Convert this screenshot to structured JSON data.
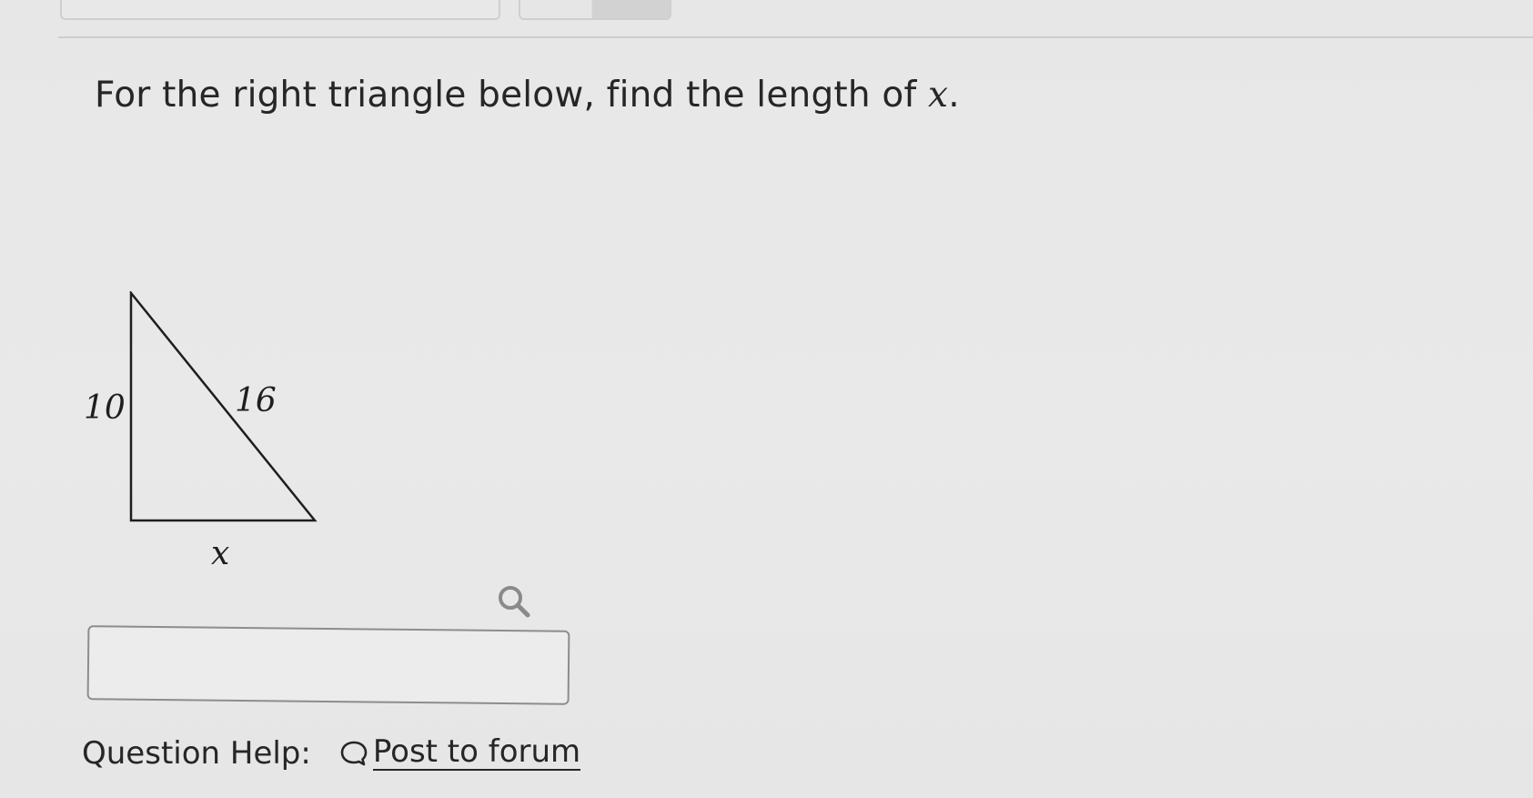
{
  "question": {
    "prefix": "For the right triangle below, find the length of ",
    "variable": "x",
    "suffix": "."
  },
  "triangle": {
    "label_vertical": "10",
    "label_hypotenuse": "16",
    "label_base": "x"
  },
  "answer": {
    "value": "",
    "placeholder": ""
  },
  "help": {
    "label": "Question Help:",
    "forum_link": "Post to forum"
  },
  "icons": {
    "search": "search-icon",
    "forum": "speech-bubble-icon"
  }
}
